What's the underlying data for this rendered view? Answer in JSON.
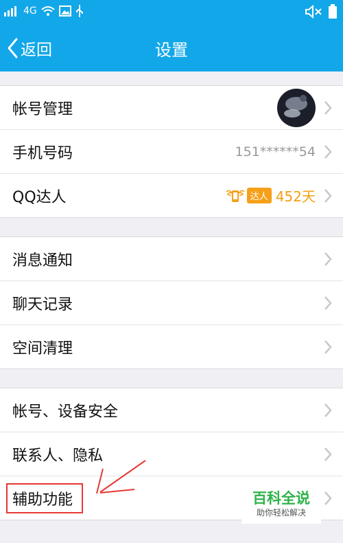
{
  "status": {
    "network": "4G"
  },
  "nav": {
    "back_label": "返回",
    "title": "设置"
  },
  "groups": [
    [
      {
        "label": "帐号管理"
      },
      {
        "label": "手机号码",
        "value": "151******54"
      },
      {
        "label": "QQ达人",
        "badge": "达人",
        "days": "452天"
      }
    ],
    [
      {
        "label": "消息通知"
      },
      {
        "label": "聊天记录"
      },
      {
        "label": "空间清理"
      }
    ],
    [
      {
        "label": "帐号、设备安全"
      },
      {
        "label": "联系人、隐私"
      },
      {
        "label": "辅助功能"
      }
    ]
  ],
  "watermark": {
    "main": "百科全说",
    "sub": "助你轻松解决"
  },
  "colors": {
    "header": "#12a7e8",
    "annotation": "#e53935",
    "badge": "#f6a01a",
    "watermark": "#2eb34a"
  }
}
